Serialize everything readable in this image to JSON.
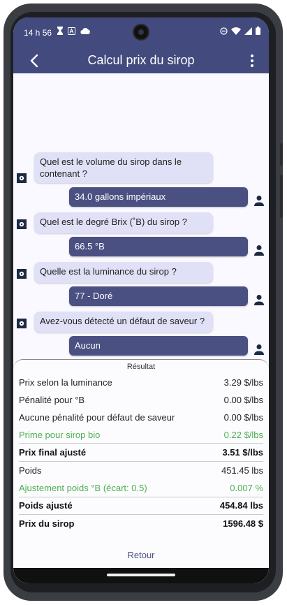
{
  "status_bar": {
    "time": "14 h 56",
    "left_icons": [
      "stopwatch-icon",
      "text-a-icon",
      "cloud-icon"
    ],
    "right_icons": [
      "do-not-disturb-icon",
      "wifi-icon",
      "signal-icon",
      "battery-icon"
    ]
  },
  "app_bar": {
    "title": "Calcul prix du sirop",
    "back_icon": "arrow-left-icon",
    "menu_icon": "more-vert-icon"
  },
  "chat": [
    {
      "question": "Quel est le volume du sirop dans le contenant ?",
      "answer": "34.0 gallons impériaux"
    },
    {
      "question": "Quel est le degré Brix (˚B) du sirop ?",
      "answer": "66.5 °B"
    },
    {
      "question": "Quelle est la luminance du sirop ?",
      "answer": "77 - Doré"
    },
    {
      "question": "Avez-vous détecté un défaut de saveur ?",
      "answer": "Aucun"
    }
  ],
  "result": {
    "title": "Résultat",
    "rows": [
      {
        "label": "Prix selon la luminance",
        "value": "3.29 $/lbs"
      },
      {
        "label": "Pénalité pour °B",
        "value": "0.00 $/lbs"
      },
      {
        "label": "Aucune pénalité pour défaut de saveur",
        "value": "0.00 $/lbs"
      },
      {
        "label": "Prime pour sirop bio",
        "value": "0.22 $/lbs"
      },
      {
        "label": "Prix final ajusté",
        "value": "3.51 $/lbs"
      },
      {
        "label": "Poids",
        "value": "451.45 lbs"
      },
      {
        "label": "Ajustement poids °B (écart: 0.5)",
        "value": "0.007 %"
      },
      {
        "label": "Poids ajusté",
        "value": "454.84 lbs"
      },
      {
        "label": "Prix du sirop",
        "value": "1596.48 $"
      }
    ],
    "back_label": "Retour"
  },
  "colors": {
    "primary": "#424a7e",
    "answer_bubble": "#4b5082",
    "question_bubble": "#e0e1f6",
    "positive": "#4caf50"
  }
}
